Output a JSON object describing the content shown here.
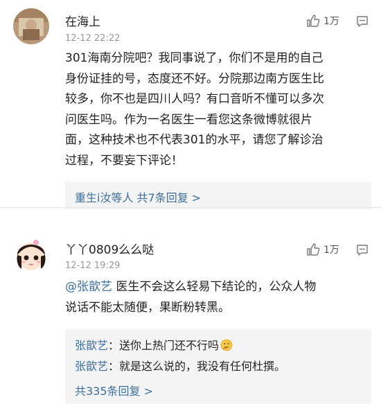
{
  "comments": [
    {
      "username": "在海上",
      "time": "12-12 22:22",
      "like_count": "1万",
      "body_lines": [
        "301海南分院吧？我同事说了，你们不是用的自己",
        "身份证挂的号，态度还不好。分院那边南方医生比",
        "较多，你不也是四川人吗？有口音听不懂可以多次",
        "问医生吗。作为一名医生一看您这条微博就很片",
        "面，这种技术也不代表301的水平，请您了解诊治",
        "过程，不要妄下评论！"
      ],
      "more_replies": "重生i汝等人  共7条回复 >"
    },
    {
      "username": "丫丫0809么么哒",
      "time": "12-12 19:29",
      "like_count": "1万",
      "mention": "@张歆艺",
      "body_line1_rest": " 医生不会这么轻易下结论的，公众人物",
      "body_line2": "说话不能太随便，果断粉转黑。",
      "replies": [
        {
          "name": "张歆艺",
          "text": "：送你上热门还不行吗"
        },
        {
          "name": "张歆艺",
          "text": "：就是这么说的，我没有任何杜撰。"
        }
      ],
      "more_replies": "共335条回复 >"
    }
  ],
  "icons": {
    "like": "thumbs-up-icon",
    "reply": "comment-icon",
    "emoji": "thinking-face-icon"
  },
  "colors": {
    "link": "#3c6e9e",
    "time": "#999999",
    "reply_bg": "#f4f4f4"
  }
}
